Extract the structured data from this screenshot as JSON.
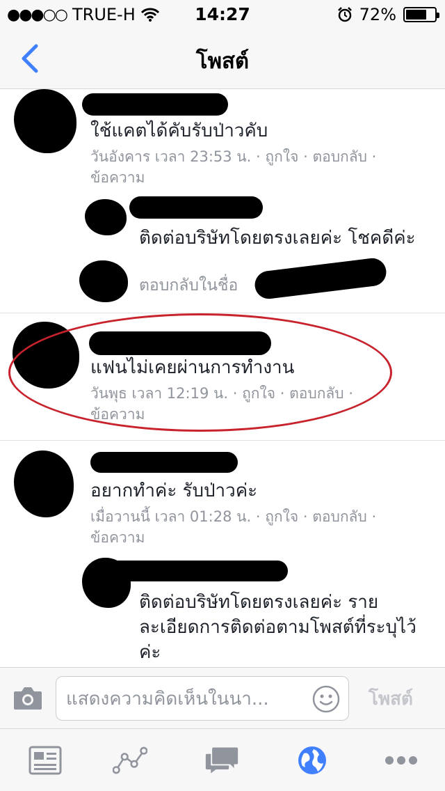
{
  "status_bar": {
    "carrier": "TRUE-H",
    "time": "14:27",
    "battery": "72%",
    "battery_level": 0.72
  },
  "nav": {
    "title": "โพสต์",
    "back_icon": "chevron-left-icon"
  },
  "comments": [
    {
      "text": "ใช้แคตได้คับรับป่าวคับ",
      "time": "วันอังคาร เวลา 23:53 น.",
      "like": "ถูกใจ",
      "reply": "ตอบกลับ",
      "message": "ข้อความ",
      "replies": [
        {
          "text": "ติดต่อบริษัทโดยตรงเลยค่ะ โชคดีค่ะ"
        }
      ],
      "reply_as": "ตอบกลับในชื่อ"
    },
    {
      "text": "แฟนไม่เคยผ่านการทำงาน",
      "time": "วันพุธ เวลา 12:19 น.",
      "like": "ถูกใจ",
      "reply": "ตอบกลับ",
      "message": "ข้อความ"
    },
    {
      "text": "อยากทำค่ะ รับป่าวค่ะ",
      "time": "เมื่อวานนี้ เวลา 01:28 น.",
      "like": "ถูกใจ",
      "reply": "ตอบกลับ",
      "message": "ข้อความ",
      "replies": [
        {
          "text_lines": [
            "ติดต่อบริษัทโดยตรงเลยค่ะ ราย",
            "ละเอียดการติดต่อตามโพสต์ที่ระบุไว้",
            "ค่ะ"
          ]
        }
      ]
    }
  ],
  "meta_separator": "·",
  "composer": {
    "placeholder": "แสดงความคิดเห็นในนา...",
    "post_label": "โพสต์"
  },
  "tabs": [
    {
      "icon": "news-feed-icon",
      "active": false
    },
    {
      "icon": "activity-graph-icon",
      "active": false
    },
    {
      "icon": "messages-icon",
      "active": false
    },
    {
      "icon": "globe-notifications-icon",
      "active": true
    },
    {
      "icon": "more-icon",
      "active": false
    }
  ],
  "colors": {
    "accent": "#4080ff",
    "meta_gray": "#90949c",
    "highlight_ring": "#c8222c"
  }
}
